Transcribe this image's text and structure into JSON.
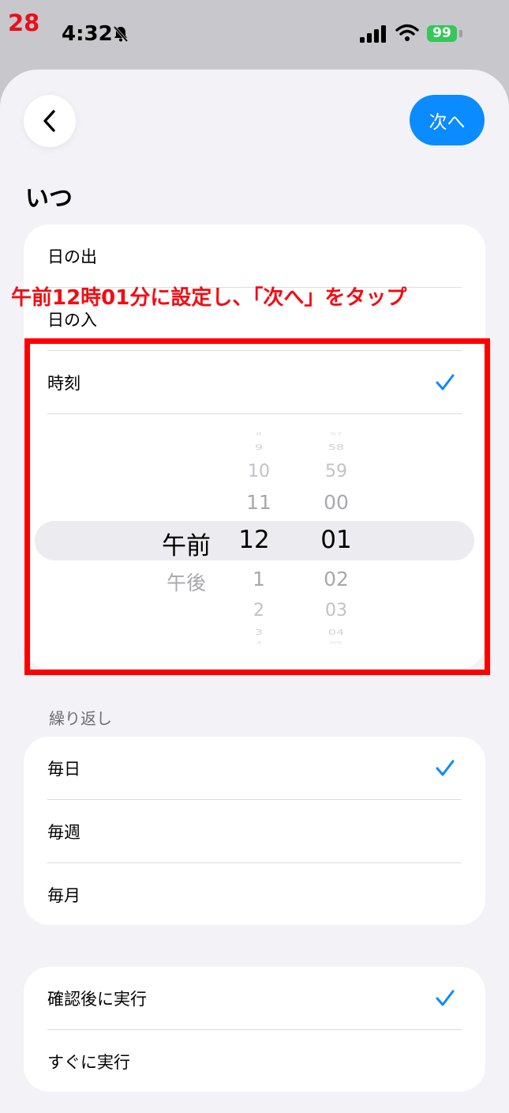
{
  "step_number": "28",
  "status_bar": {
    "time": "4:32",
    "battery": "99"
  },
  "nav": {
    "next_label": "次へ"
  },
  "when_section": {
    "title": "いつ",
    "options": [
      {
        "label": "日の出",
        "checked": false
      },
      {
        "label": "日の入",
        "checked": false
      },
      {
        "label": "時刻",
        "checked": true
      }
    ]
  },
  "time_picker": {
    "period": {
      "selected": "午前",
      "below": [
        "午後"
      ]
    },
    "hour": {
      "above": [
        "8",
        "9",
        "10",
        "11"
      ],
      "selected": "12",
      "below": [
        "1",
        "2",
        "3",
        "4"
      ]
    },
    "minute": {
      "above": [
        "57",
        "58",
        "59",
        "00"
      ],
      "selected": "01",
      "below": [
        "02",
        "03",
        "04",
        "05"
      ]
    }
  },
  "repeat_section": {
    "title": "繰り返し",
    "options": [
      {
        "label": "毎日",
        "checked": true
      },
      {
        "label": "毎週",
        "checked": false
      },
      {
        "label": "毎月",
        "checked": false
      }
    ]
  },
  "run_section": {
    "options": [
      {
        "label": "確認後に実行",
        "checked": true
      },
      {
        "label": "すぐに実行",
        "checked": false
      }
    ]
  },
  "annotation": "午前12時01分に設定し、「次へ」をタップ",
  "colors": {
    "accent": "#0a8bff",
    "annotation_red": "#ff0000",
    "battery_green": "#34c759"
  }
}
